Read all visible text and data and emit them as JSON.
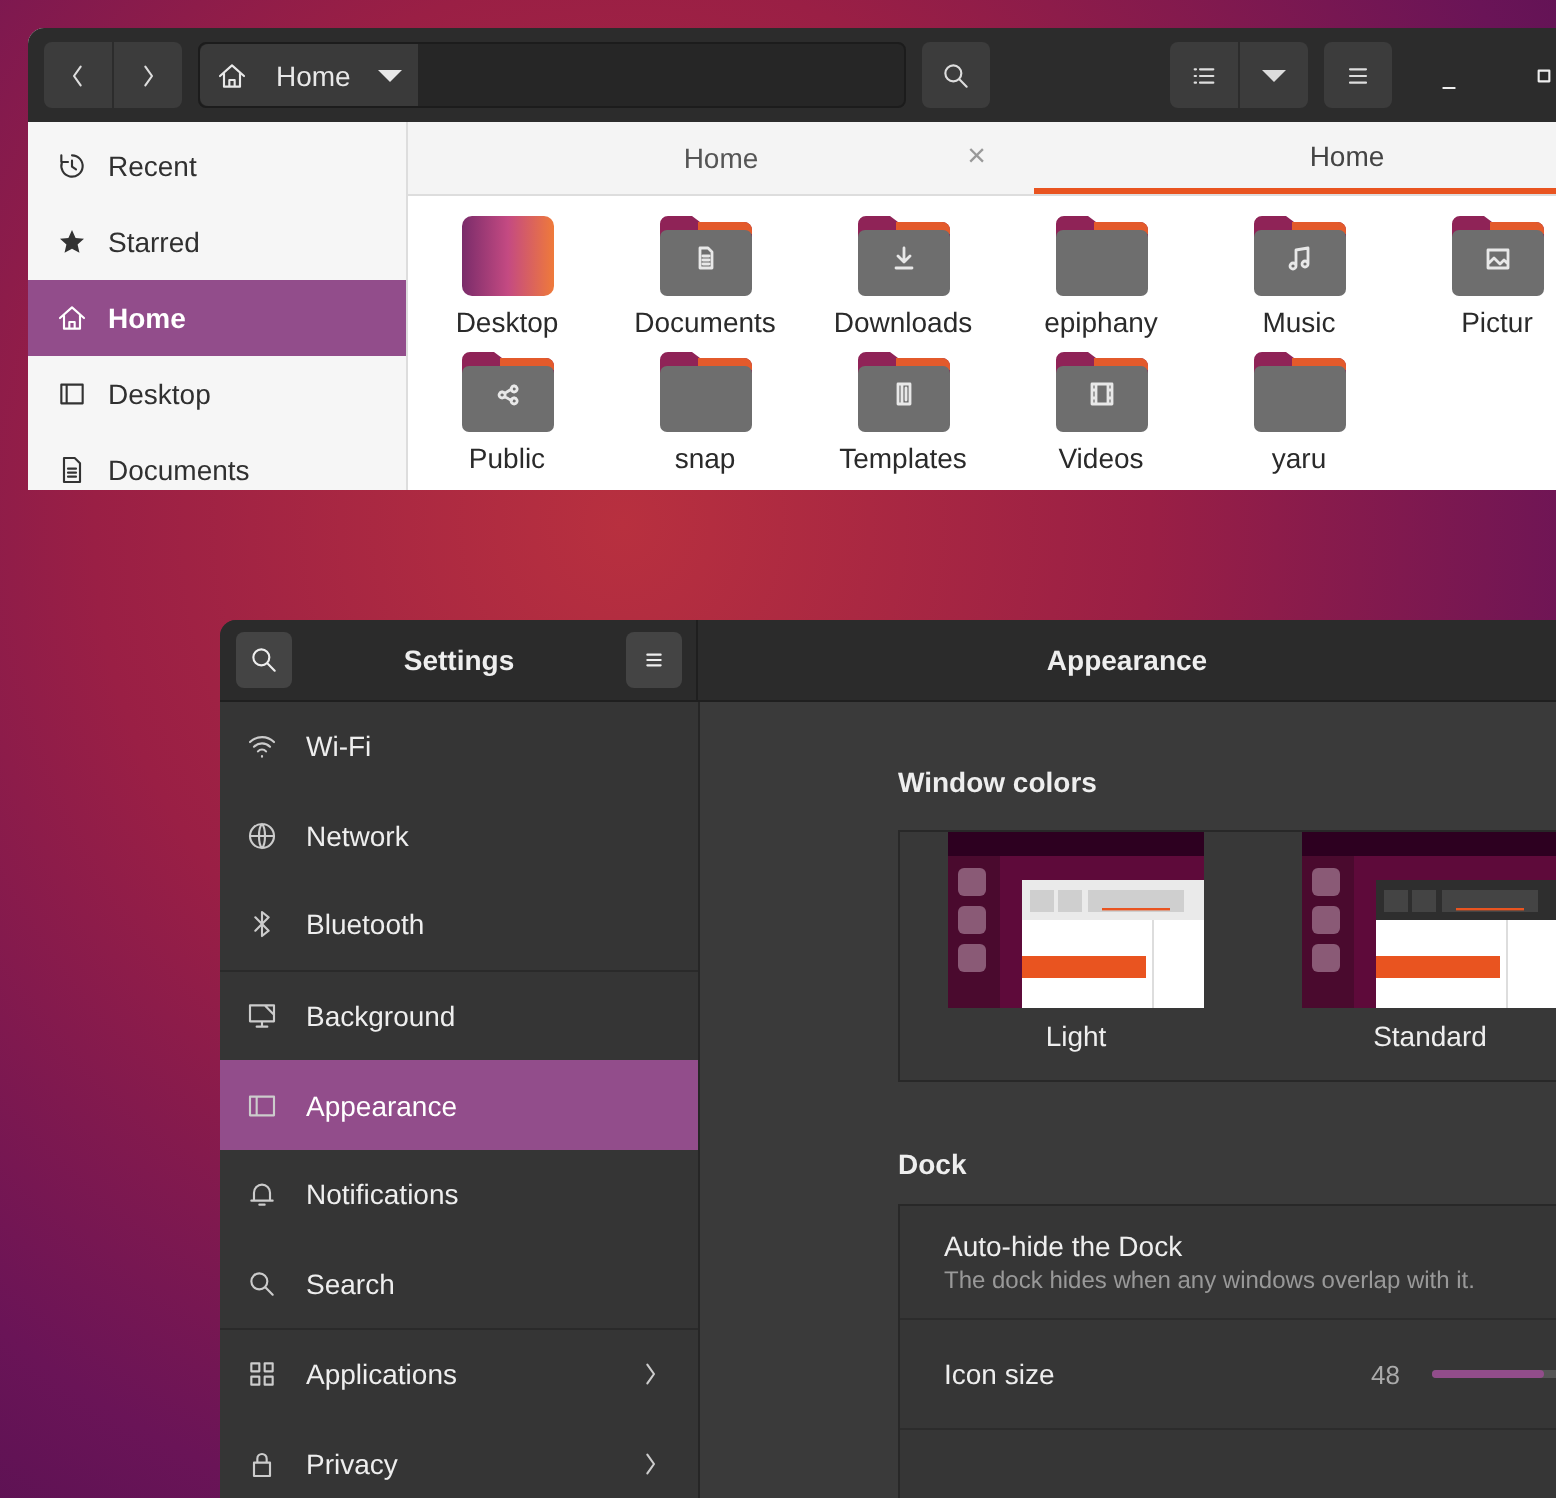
{
  "files": {
    "path": {
      "label": "Home"
    },
    "sidebar": [
      {
        "label": "Recent",
        "kind": "recent",
        "selected": false
      },
      {
        "label": "Starred",
        "kind": "starred",
        "selected": false
      },
      {
        "label": "Home",
        "kind": "home",
        "selected": true
      },
      {
        "label": "Desktop",
        "kind": "desktop",
        "selected": false
      },
      {
        "label": "Documents",
        "kind": "documents",
        "selected": false
      }
    ],
    "tabs": [
      {
        "label": "Home",
        "selected": false,
        "close": "×"
      },
      {
        "label": "Home",
        "selected": true
      }
    ],
    "items": [
      {
        "name": "Desktop",
        "kind": "desktop"
      },
      {
        "name": "Documents",
        "kind": "documents"
      },
      {
        "name": "Downloads",
        "kind": "downloads"
      },
      {
        "name": "epiphany",
        "kind": "plain"
      },
      {
        "name": "Music",
        "kind": "music"
      },
      {
        "name": "Pictur",
        "kind": "pictures"
      },
      {
        "name": "Public",
        "kind": "public"
      },
      {
        "name": "snap",
        "kind": "plain"
      },
      {
        "name": "Templates",
        "kind": "templates"
      },
      {
        "name": "Videos",
        "kind": "videos"
      },
      {
        "name": "yaru",
        "kind": "plain"
      }
    ]
  },
  "settings": {
    "title": "Settings",
    "page_title": "Appearance",
    "sidebar_groups": [
      {
        "items": [
          {
            "label": "Wi-Fi",
            "kind": "wifi",
            "selected": false,
            "submenu": false
          },
          {
            "label": "Network",
            "kind": "network",
            "selected": false,
            "submenu": false
          },
          {
            "label": "Bluetooth",
            "kind": "bluetooth",
            "selected": false,
            "submenu": false
          }
        ]
      },
      {
        "items": [
          {
            "label": "Background",
            "kind": "background",
            "selected": false,
            "submenu": false
          },
          {
            "label": "Appearance",
            "kind": "appearance",
            "selected": true,
            "submenu": false
          },
          {
            "label": "Notifications",
            "kind": "notifications",
            "selected": false,
            "submenu": false
          },
          {
            "label": "Search",
            "kind": "search",
            "selected": false,
            "submenu": false
          }
        ]
      },
      {
        "items": [
          {
            "label": "Applications",
            "kind": "applications",
            "selected": false,
            "submenu": true
          },
          {
            "label": "Privacy",
            "kind": "privacy",
            "selected": false,
            "submenu": true
          }
        ]
      }
    ],
    "window_colors": {
      "heading": "Window colors",
      "options": [
        {
          "label": "Light",
          "kind": "light"
        },
        {
          "label": "Standard",
          "kind": "standard"
        }
      ]
    },
    "dock": {
      "heading": "Dock",
      "auto_hide": {
        "title": "Auto-hide the Dock",
        "subtitle": "The dock hides when any windows overlap with it."
      },
      "icon_size": {
        "label": "Icon size",
        "reading": "48",
        "level": 0.667
      }
    }
  }
}
